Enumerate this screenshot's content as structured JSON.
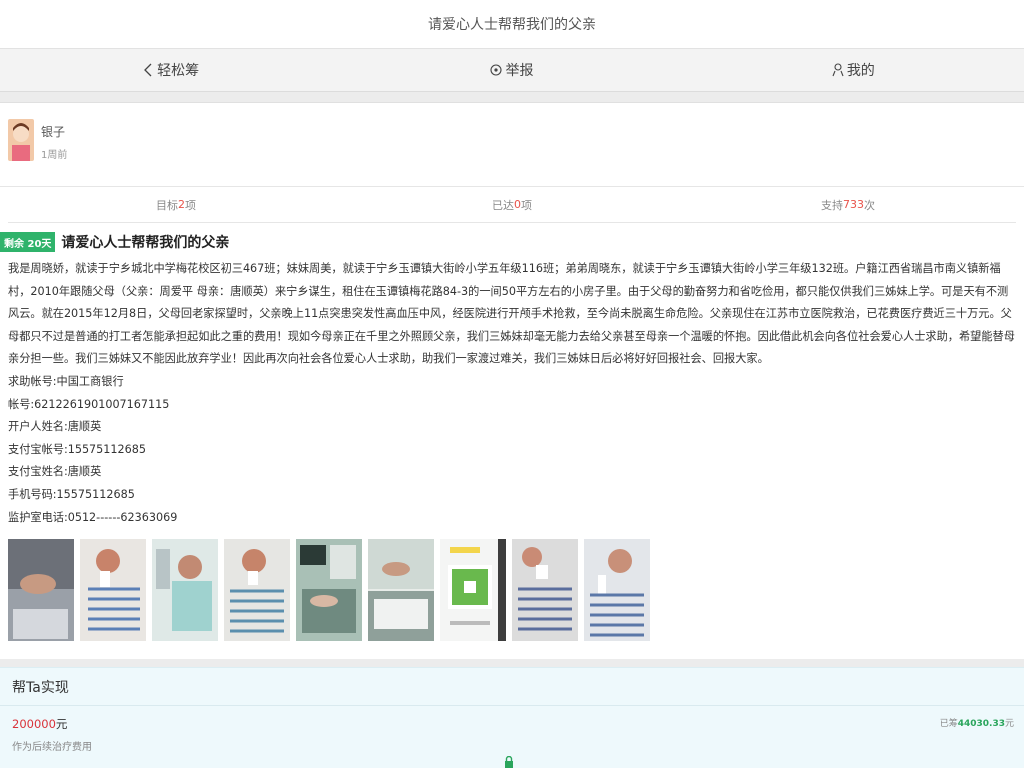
{
  "header": {
    "title": "请爱心人士帮帮我们的父亲"
  },
  "nav": [
    {
      "label": "轻松筹",
      "icon": "chevron-left-icon"
    },
    {
      "label": "举报",
      "icon": "report-icon"
    },
    {
      "label": "我的",
      "icon": "user-icon"
    }
  ],
  "user": {
    "name": "银子",
    "time": "1周前"
  },
  "stats": {
    "target_label": "目标",
    "target_value": "2",
    "target_unit": "项",
    "reached_label": "已达",
    "reached_value": "0",
    "reached_unit": "项",
    "support_label": "支持",
    "support_value": "733",
    "support_unit": "次"
  },
  "post": {
    "badge": "剩余 20天",
    "title": "请爱心人士帮帮我们的父亲",
    "body": "我是周晓娇，就读于宁乡城北中学梅花校区初三467班；妹妹周美，就读于宁乡玉谭镇大街岭小学五年级116班；弟弟周晓东，就读于宁乡玉谭镇大街岭小学三年级132班。户籍江西省瑞昌市南义镇新福村，2010年跟随父母（父亲：周爱平 母亲：唐顺英）来宁乡谋生，租住在玉谭镇梅花路84-3的一间50平方左右的小房子里。由于父母的勤奋努力和省吃俭用，都只能仅供我们三姊妹上学。可是天有不测风云。就在2015年12月8日，父母回老家探望时，父亲晚上11点突患突发性高血压中风，经医院进行开颅手术抢救，至今尚未脱离生命危险。父亲现住在江苏市立医院救治，已花费医疗费近三十万元。父母都只不过是普通的打工者怎能承担起如此之重的费用！现如今母亲正在千里之外照顾父亲，我们三姊妹却毫无能力去给父亲甚至母亲一个温暖的怀抱。因此借此机会向各位社会爱心人士求助，希望能替母亲分担一些。我们三姊妹又不能因此放弃学业！因此再次向社会各位爱心人士求助，助我们一家渡过难关，我们三姊妹日后必将好好回报社会、回报大家。",
    "info": [
      "求助帐号:中国工商银行",
      "帐号:6212261901007167115",
      "开户人姓名:唐顺英",
      "支付宝帐号:15575112685",
      "支付宝姓名:唐顺英",
      "手机号码:15575112685",
      "监护室电话:0512------62363069"
    ]
  },
  "photos": [
    {
      "alt": "photo-1"
    },
    {
      "alt": "photo-2"
    },
    {
      "alt": "photo-3"
    },
    {
      "alt": "photo-4"
    },
    {
      "alt": "photo-5"
    },
    {
      "alt": "photo-6"
    },
    {
      "alt": "photo-7"
    },
    {
      "alt": "photo-8"
    },
    {
      "alt": "photo-9"
    }
  ],
  "helper": {
    "title": "帮Ta实现",
    "amount_value": "200000",
    "amount_unit": "元",
    "purpose": "作为后续治疗费用",
    "raised_label": "已筹",
    "raised_value": "44030.33",
    "raised_unit": "元"
  },
  "colors": {
    "accent_green": "#2fb36b",
    "highlight_red": "#e8534a"
  }
}
